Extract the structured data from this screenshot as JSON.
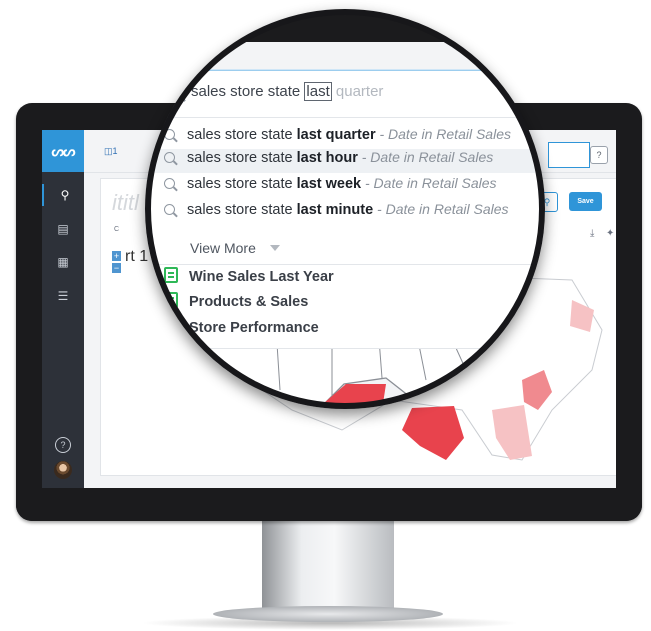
{
  "app": {
    "logo_text": "ᔕᔕ",
    "source_indicator": "1",
    "help_glyph": "?",
    "save_label": "Save",
    "chart_label": "C",
    "chart_name": "rt 1",
    "card_title": "ititl",
    "zoom_in": "+",
    "zoom_out": "−",
    "sidebar_icons": [
      "search-icon",
      "answer-icon",
      "pinboard-icon",
      "data-icon"
    ]
  },
  "search": {
    "typed": "sales store state ",
    "typed_last": "last",
    "completion": " quarter"
  },
  "suggestions": [
    {
      "prefix": "sales store state ",
      "bold": "last quarter",
      "context": " - Date in Retail Sales"
    },
    {
      "prefix": "sales store state ",
      "bold": "last hour",
      "context": " - Date in Retail Sales"
    },
    {
      "prefix": "sales store state ",
      "bold": "last week",
      "context": " - Date in Retail Sales"
    },
    {
      "prefix": "sales store state ",
      "bold": "last minute",
      "context": " - Date in Retail Sales"
    }
  ],
  "view_more_label": "View More",
  "pinboards": [
    {
      "label": "Wine Sales Last Year"
    },
    {
      "label": "Products & Sales"
    },
    {
      "label": "Store Performance"
    }
  ],
  "colors": {
    "accent": "#2f95d8",
    "pinboard_icon": "#2eb857",
    "map_high": "#e8434d",
    "map_mid": "#f08a8f",
    "map_low": "#f6c2c4"
  }
}
